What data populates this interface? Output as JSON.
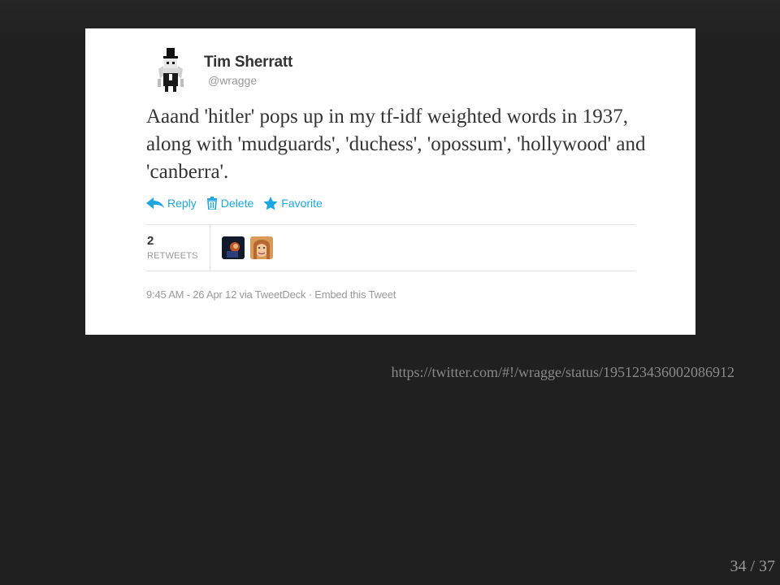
{
  "tweet": {
    "user_name": "Tim Sherratt",
    "user_handle": "@wragge",
    "text": "Aaand 'hitler' pops up in my tf-idf weighted words in 1937, along with 'mudguards', 'duchess', 'opossum', 'hollywood' and 'canberra'.",
    "actions": {
      "reply": "Reply",
      "delete": "Delete",
      "favorite": "Favorite"
    },
    "retweets": {
      "count": "2",
      "label": "RETWEETS"
    },
    "meta": {
      "timestamp": "9:45 AM - 26 Apr 12",
      "via_prefix": "via",
      "client": "TweetDeck",
      "separator": "·",
      "embed": "Embed this Tweet"
    }
  },
  "slide": {
    "source_url": "https://twitter.com/#!/wragge/status/195123436002086912",
    "page_counter": "34 / 37"
  },
  "colors": {
    "background": "#222222",
    "card": "#ffffff",
    "link": "#1ea6e0",
    "text": "#333333",
    "muted": "#999999"
  },
  "icons": {
    "reply": "reply-arrow-icon",
    "delete": "trash-icon",
    "favorite": "star-icon",
    "avatar": "user-avatar"
  }
}
